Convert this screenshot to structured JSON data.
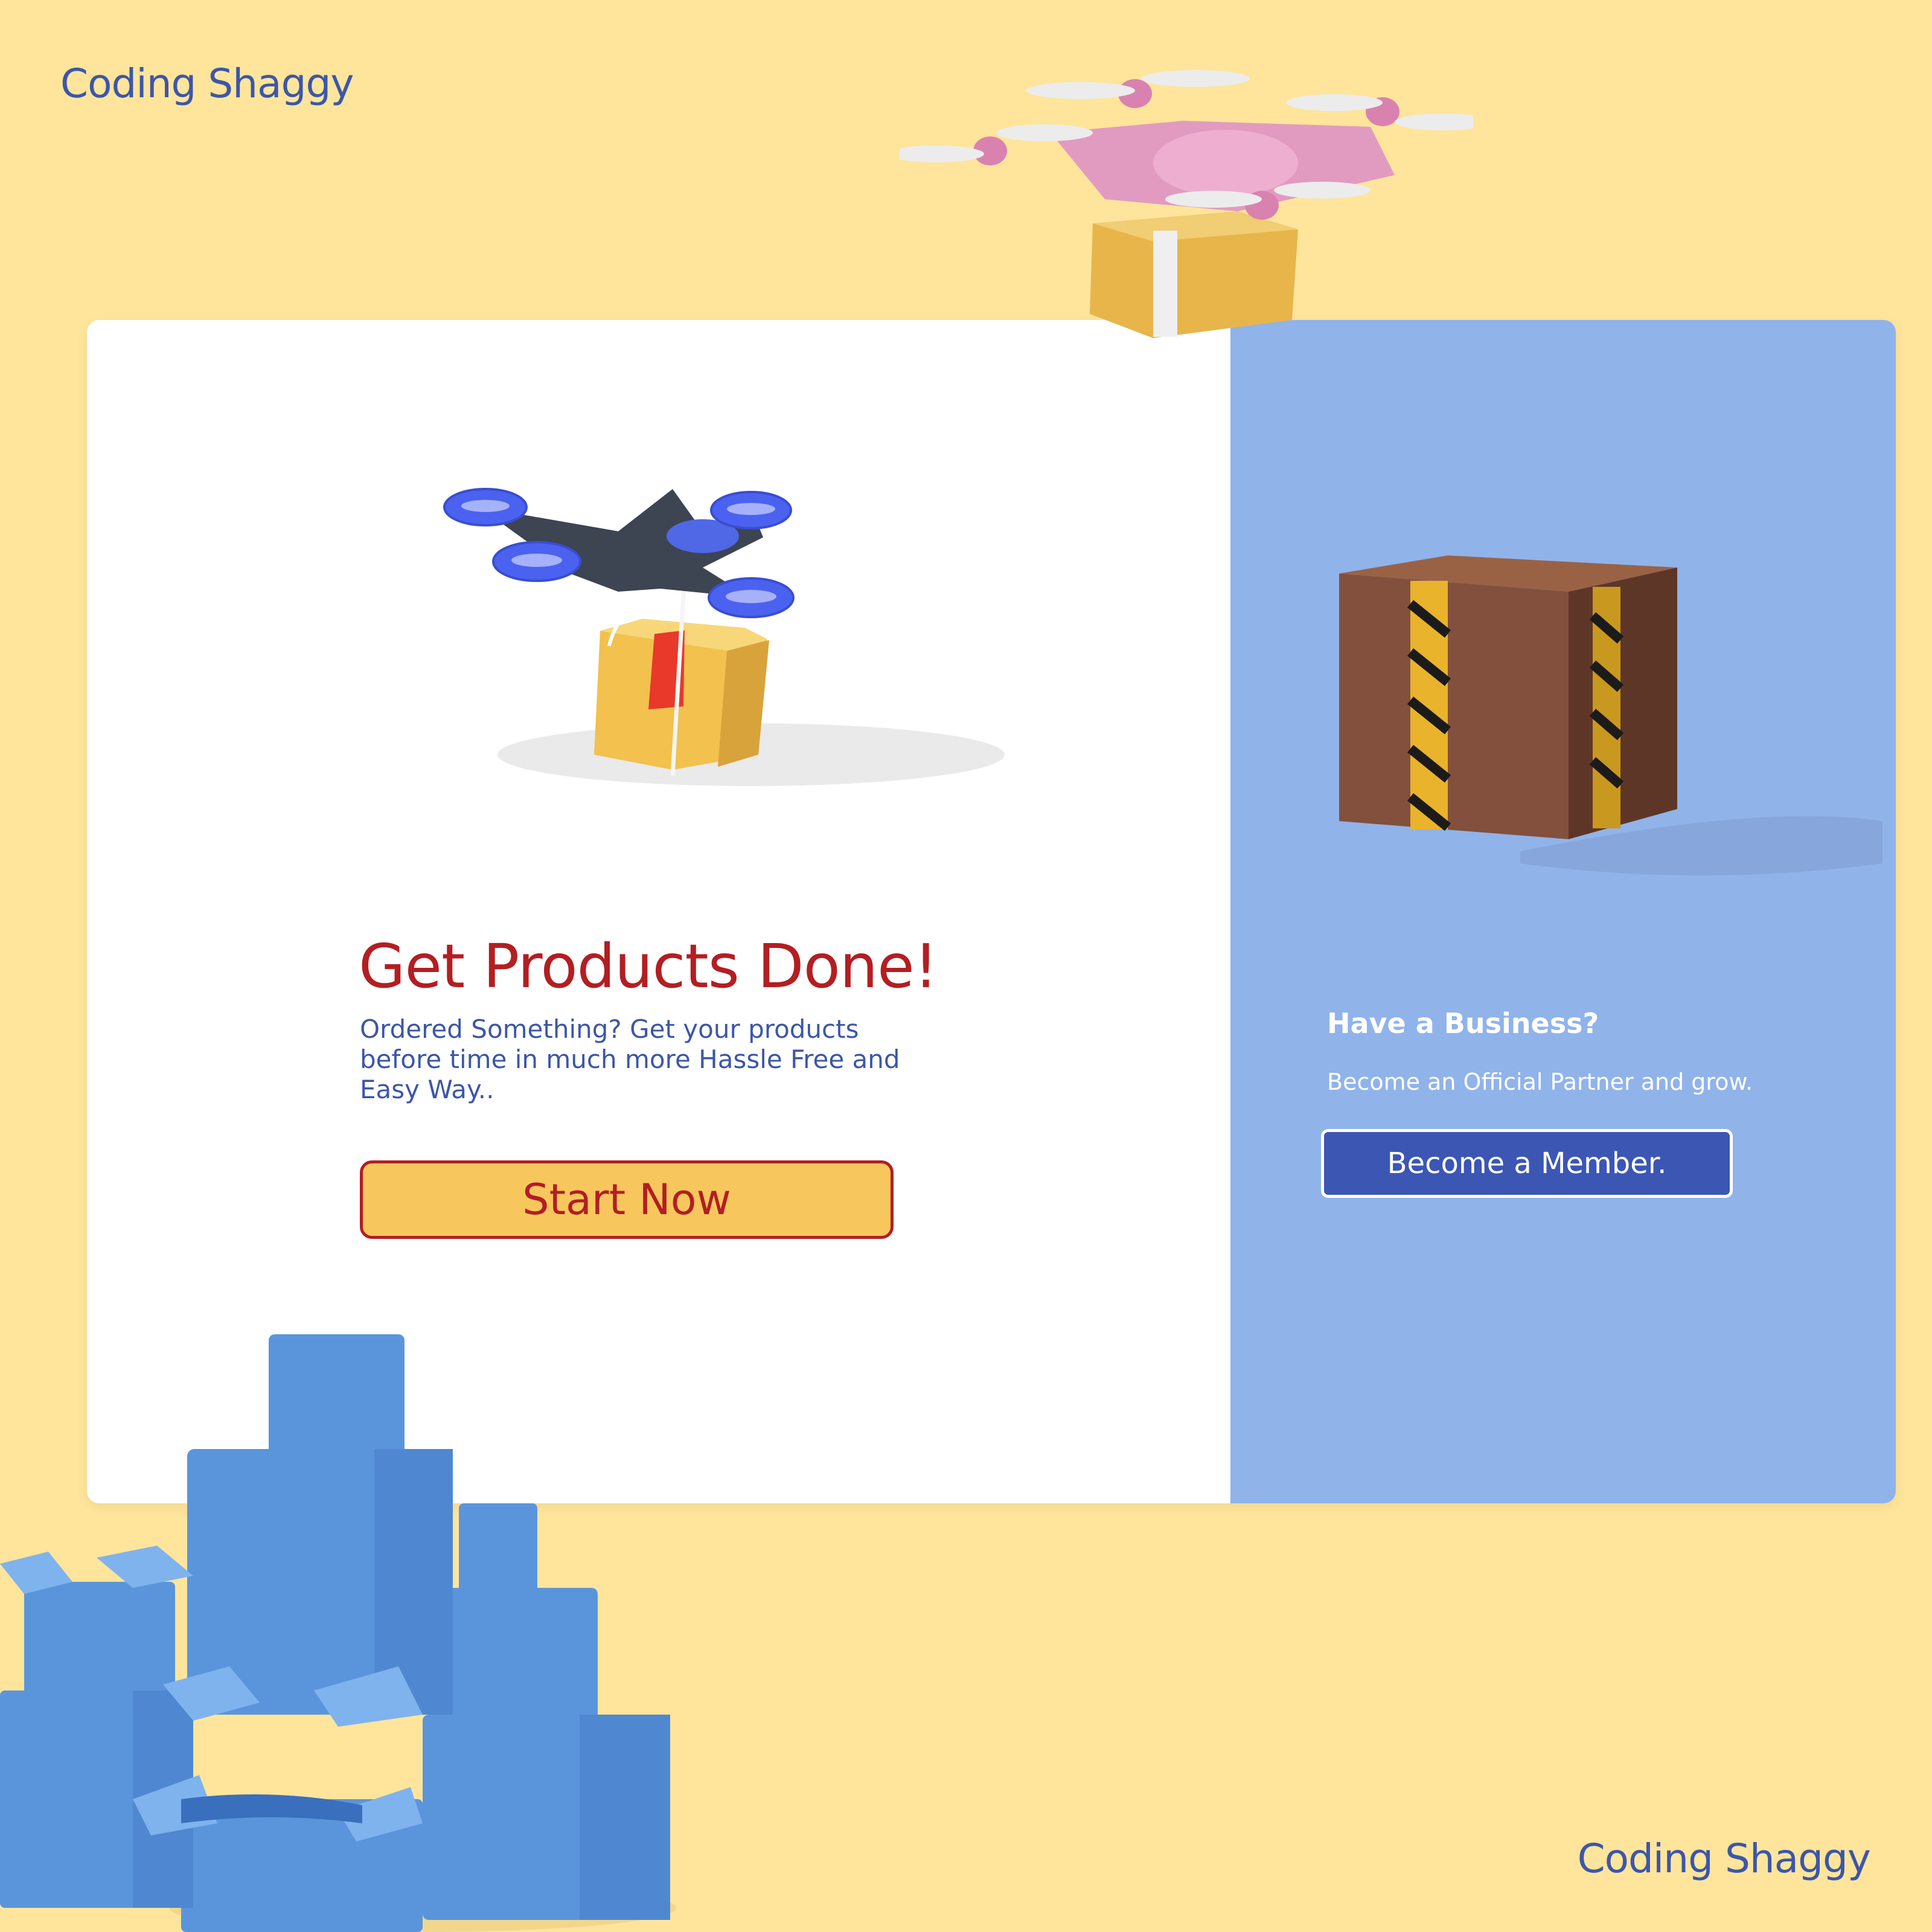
{
  "brand": {
    "top": "Coding Shaggy",
    "bottom": "Coding Shaggy"
  },
  "hero": {
    "headline": "Get Products Done!",
    "description": "Ordered  Something?  Get your products before time in much more Hassle Free and Easy Way..",
    "cta_label": "Start Now"
  },
  "business": {
    "title": "Have a Business?",
    "subtitle": "Become an Official Partner and grow.",
    "cta_label": "Become a Member."
  },
  "colors": {
    "page_background": "#fee59b",
    "brand_blue": "#3c56a9",
    "accent_red": "#b31e22",
    "cta_yellow": "#f7c75e",
    "panel_blue": "#90b3ea",
    "member_button": "#3c56b4"
  },
  "illustrations": [
    "drone-with-package-icon",
    "pink-drone-icon",
    "taped-parcel-icon",
    "blue-box-stack-icon"
  ]
}
